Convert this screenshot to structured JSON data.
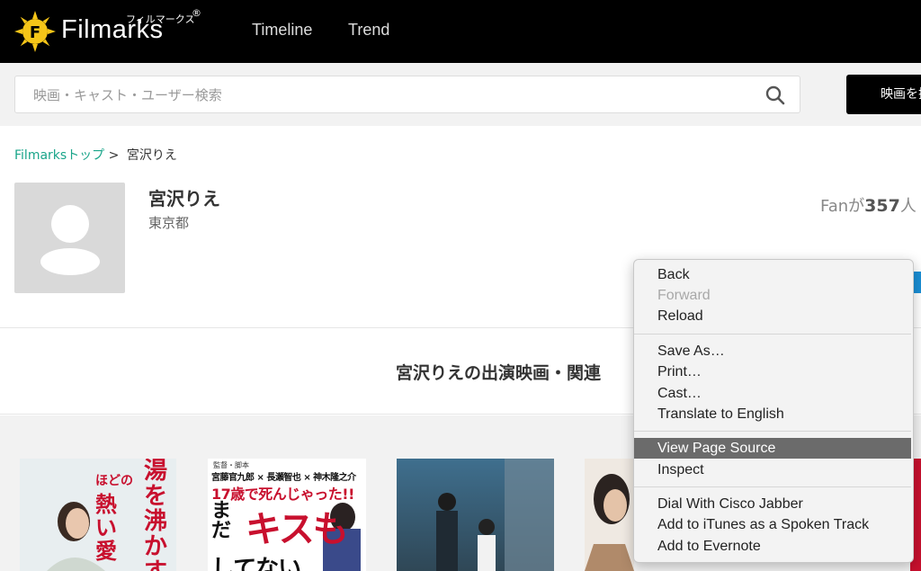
{
  "header": {
    "logo_text": "Filmarks",
    "logo_kana": "フィルマークス",
    "logo_reg": "®",
    "nav": [
      "Timeline",
      "Trend"
    ]
  },
  "search": {
    "placeholder": "映画・キャスト・ユーザー検索",
    "button_label": "映画を探す"
  },
  "breadcrumb": {
    "home": "Filmarksトップ",
    "sep": ">",
    "current": "宮沢りえ"
  },
  "person": {
    "name": "宮沢りえ",
    "location": "東京都",
    "fans_prefix": "Fanが",
    "fans_count": "357",
    "fans_suffix": "人"
  },
  "section_title": "宮沢りえの出演映画・関連",
  "posters": [
    {
      "alt": "湯を沸かすほどの熱い愛",
      "line1": "湯を",
      "line2": "沸かす",
      "side1": "ほどの",
      "side2": "熱い",
      "side3": "愛"
    },
    {
      "alt": "17歳で死んじゃった!! まだキスもしてない",
      "top_a": "監督・脚本",
      "top_b": "宮藤官九郎 × 長瀬智也 × 神木隆之介",
      "headline": "17歳で死んじゃった!!",
      "big": "キスも",
      "left": "まだ",
      "bottom": "してない"
    },
    {
      "alt": "poster 3"
    },
    {
      "alt": "poster 4"
    }
  ],
  "context_menu": {
    "items": [
      {
        "label": "Back",
        "state": "normal"
      },
      {
        "label": "Forward",
        "state": "disabled"
      },
      {
        "label": "Reload",
        "state": "normal"
      },
      {
        "label": "Save As…",
        "state": "normal"
      },
      {
        "label": "Print…",
        "state": "normal"
      },
      {
        "label": "Cast…",
        "state": "normal"
      },
      {
        "label": "Translate to English",
        "state": "normal"
      },
      {
        "label": "View Page Source",
        "state": "highlighted"
      },
      {
        "label": "Inspect",
        "state": "normal"
      },
      {
        "label": "Dial With Cisco Jabber",
        "state": "normal"
      },
      {
        "label": "Add to iTunes as a Spoken Track",
        "state": "normal"
      },
      {
        "label": "Add to Evernote",
        "state": "normal"
      }
    ]
  },
  "colors": {
    "accent_link": "#1aa58a",
    "logo_sun": "#f5c518",
    "highlight": "#6b6b6b"
  }
}
